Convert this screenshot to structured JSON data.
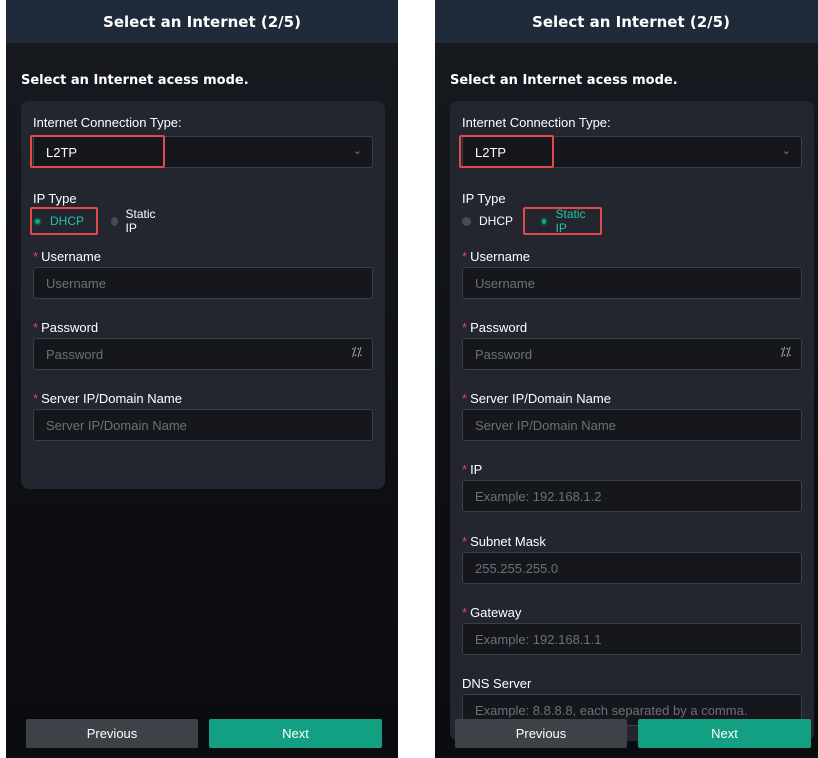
{
  "app": {
    "title": "Select an Internet (2/5)"
  },
  "subtitle": "Select an Internet acess mode.",
  "left": {
    "connection_type_label": "Internet Connection Type:",
    "connection_type_value": "L2TP",
    "ip_type_label": "IP Type",
    "ip_type_options": [
      "DHCP",
      "Static IP"
    ],
    "ip_type_selected": "DHCP",
    "fields": [
      {
        "label": "Username",
        "placeholder": "Username",
        "required": true
      },
      {
        "label": "Password",
        "placeholder": "Password",
        "required": true
      },
      {
        "label": "Server IP/Domain Name",
        "placeholder": "Server IP/Domain Name",
        "required": true
      }
    ],
    "buttons": {
      "previous": "Previous",
      "next": "Next"
    }
  },
  "right": {
    "connection_type_label": "Internet Connection Type:",
    "connection_type_value": "L2TP",
    "ip_type_label": "IP Type",
    "ip_type_options": [
      "DHCP",
      "Static IP"
    ],
    "ip_type_selected": "Static IP",
    "fields": [
      {
        "label": "Username",
        "placeholder": "Username",
        "required": true
      },
      {
        "label": "Password",
        "placeholder": "Password",
        "required": true
      },
      {
        "label": "Server IP/Domain Name",
        "placeholder": "Server IP/Domain Name",
        "required": true
      },
      {
        "label": "IP",
        "placeholder": "Example: 192.168.1.2",
        "required": true
      },
      {
        "label": "Subnet Mask",
        "placeholder": "255.255.255.0",
        "required": true
      },
      {
        "label": "Gateway",
        "placeholder": "Example: 192.168.1.1",
        "required": true
      },
      {
        "label": "DNS Server",
        "placeholder": "Example: 8.8.8.8, each separated by a comma.",
        "required": false
      }
    ],
    "buttons": {
      "previous": "Previous",
      "next": "Next"
    }
  },
  "icons": {
    "required_mark": "*",
    "chevron": "chevron-down-icon",
    "eye": "eye-closed-icon"
  },
  "colors": {
    "accent": "#139f82",
    "highlight": "#e04a4a",
    "required": "#e5484d"
  }
}
